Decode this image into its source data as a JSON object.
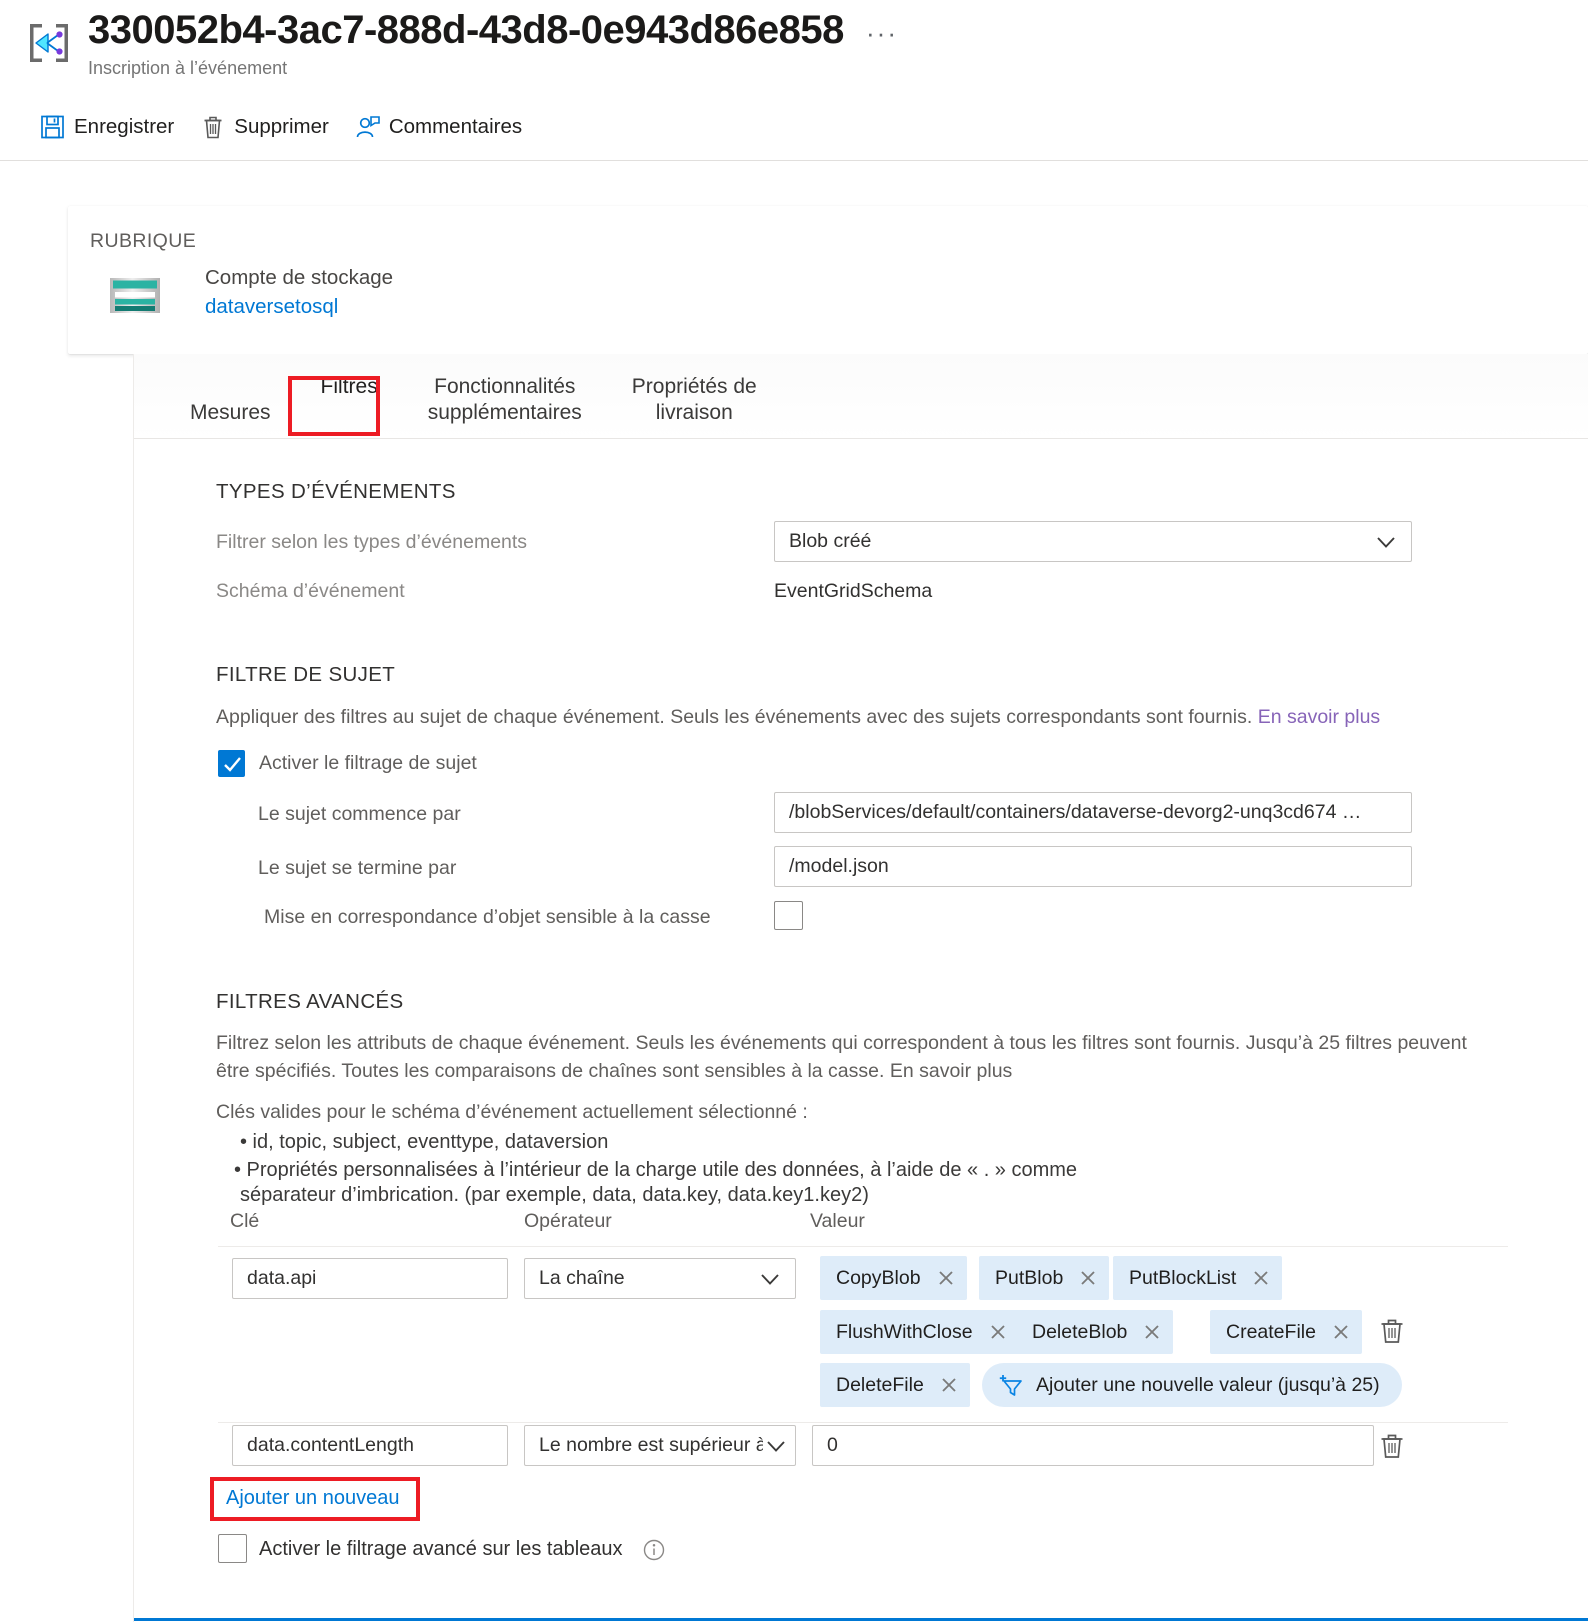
{
  "header": {
    "title": "330052b4-3ac7-888d-43d8-0e943d86e858",
    "subtitle": "Inscription à l’événement",
    "ellipsis": "···",
    "icon": "event-subscription-icon",
    "commands": [
      {
        "label": "Enregistrer",
        "icon": "save-icon"
      },
      {
        "label": "Supprimer",
        "icon": "delete-icon"
      },
      {
        "label": "Commentaires",
        "icon": "feedback-icon"
      }
    ]
  },
  "topic_card": {
    "label": "RUBRIQUE",
    "icon": "storage-account-icon",
    "resource_type": "Compte de stockage",
    "resource_name": "dataversetosql"
  },
  "tabs": [
    {
      "label": "Mesures",
      "active": false
    },
    {
      "label": "Filtres",
      "active": true
    },
    {
      "label": "Fonctionnalités\nsupplémentaires",
      "active": false
    },
    {
      "label": "Propriétés de\nlivraison",
      "active": false
    }
  ],
  "event_types": {
    "section_title": "TYPES D’ÉVÉNEMENTS",
    "filter_label": "Filtrer selon les types d’événements",
    "filter_value": "Blob créé",
    "schema_label": "Schéma d’événement",
    "schema_value": "EventGridSchema"
  },
  "subject_filter": {
    "section_title": "FILTRE DE SUJET",
    "description": "Appliquer des filtres au sujet de chaque événement. Seuls les événements avec des sujets correspondants sont fournis. ",
    "learn_more": "En savoir plus",
    "enable_label": "Activer le filtrage de sujet",
    "enable_checked": true,
    "begins_with_label": "Le sujet commence par",
    "begins_with_value": "/blobServices/default/containers/dataverse-devorg2-unq3cd674 …",
    "ends_with_label": "Le sujet se termine par",
    "ends_with_value": "/model.json",
    "case_sensitive_label": "Mise en correspondance d’objet sensible à la casse",
    "case_sensitive_checked": false
  },
  "advanced_filters": {
    "section_title": "FILTRES AVANCÉS",
    "description_line1": "Filtrez selon les attributs de chaque événement. Seuls les événements qui correspondent à tous les filtres sont fournis. Jusqu’à 25 filtres peuvent",
    "description_line2": "être spécifiés. Toutes les comparaisons de chaînes sont sensibles à la casse. En savoir plus",
    "keys_intro": "Clés valides pour le schéma d’événement actuellement sélectionné :",
    "bullet1": "•  id, topic, subject, eventtype, dataversion",
    "bullet2_line1": "• Propriétés personnalisées à l’intérieur de la charge utile des données, à l’aide de « . » comme",
    "bullet2_line2": "séparateur d’imbrication. (par exemple, data, data.key, data.key1.key2)",
    "columns": {
      "key": "Clé",
      "operator": "Opérateur",
      "value": "Valeur"
    },
    "rows": [
      {
        "key": "data.api",
        "operator": "La chaîne",
        "chips": [
          "CopyBlob",
          "PutBlob",
          "PutBlockList",
          "FlushWithClose",
          "DeleteBlob",
          "CreateFile",
          "DeleteFile"
        ],
        "add_value_label": "Ajouter une nouvelle valeur (jusqu’à 25)"
      },
      {
        "key": "data.contentLength",
        "operator": "Le nombre est supérieur à...",
        "value": "0"
      }
    ],
    "add_new_label": "Ajouter un nouveau",
    "array_filter_label": "Activer le filtrage avancé sur les tableaux",
    "array_filter_checked": false
  },
  "colors": {
    "accent": "#0078d4",
    "highlight": "#ed1c24",
    "chip_bg": "#deecf9",
    "link_purple": "#8764b8",
    "teal": "#2bb3a3"
  }
}
